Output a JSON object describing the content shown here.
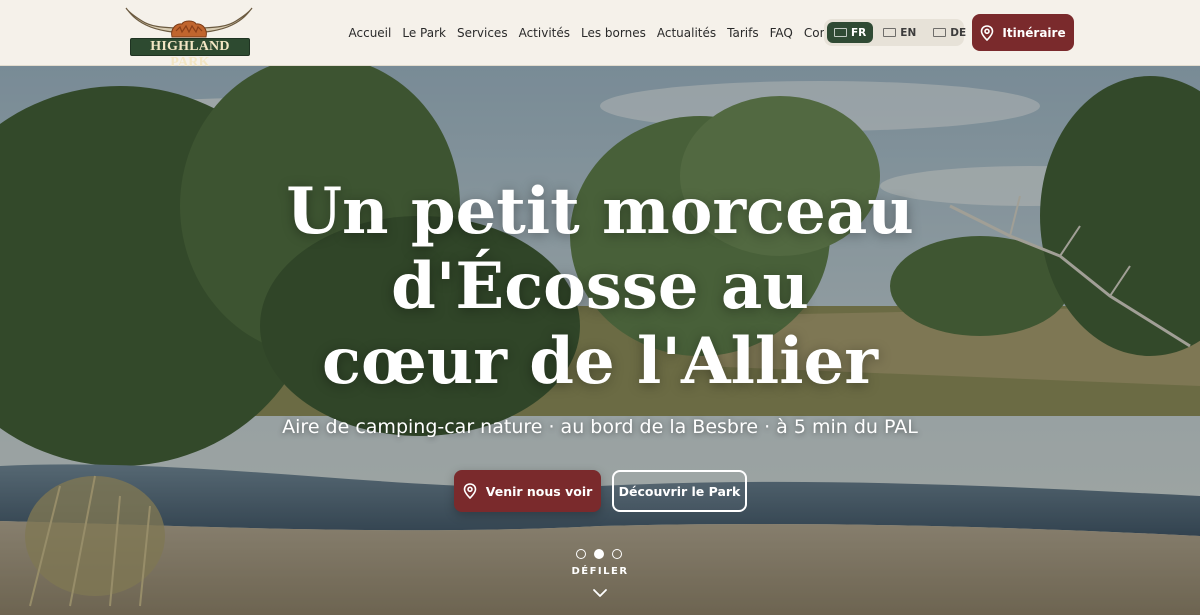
{
  "brand": {
    "logo_text": "HIGHLAND PARK"
  },
  "nav": {
    "items": [
      "Accueil",
      "Le Park",
      "Services",
      "Activités",
      "Les bornes",
      "Actualités",
      "Tarifs",
      "FAQ",
      "Contact"
    ]
  },
  "languages": {
    "items": [
      {
        "code": "FR",
        "active": true
      },
      {
        "code": "EN",
        "active": false
      },
      {
        "code": "DE",
        "active": false
      }
    ]
  },
  "header_cta": {
    "label": "Itinéraire",
    "icon": "map-pin-icon"
  },
  "hero": {
    "title_lines": [
      "Un petit morceau",
      "d'Écosse au",
      "cœur de l'Allier"
    ],
    "subtitle": "Aire de camping-car nature · au bord de la Besbre · à 5 min du PAL",
    "primary_cta": {
      "label": "Venir nous voir",
      "icon": "map-pin-icon"
    },
    "secondary_cta": {
      "label": "Découvrir le Park"
    },
    "slider": {
      "count": 3,
      "active_index": 1
    },
    "scroll_label": "DÉFILER",
    "scroll_icon": "chevron-down-icon"
  },
  "colors": {
    "background": "#f5f1ea",
    "accent": "#7a2a2c",
    "forest": "#2f4a34",
    "text": "#2a2a2a"
  }
}
